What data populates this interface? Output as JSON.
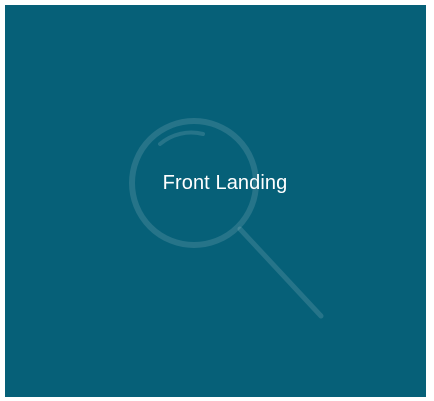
{
  "tile": {
    "label": "Front Landing",
    "background_color": "#066078",
    "text_color": "#ffffff",
    "icon": "search-icon"
  }
}
